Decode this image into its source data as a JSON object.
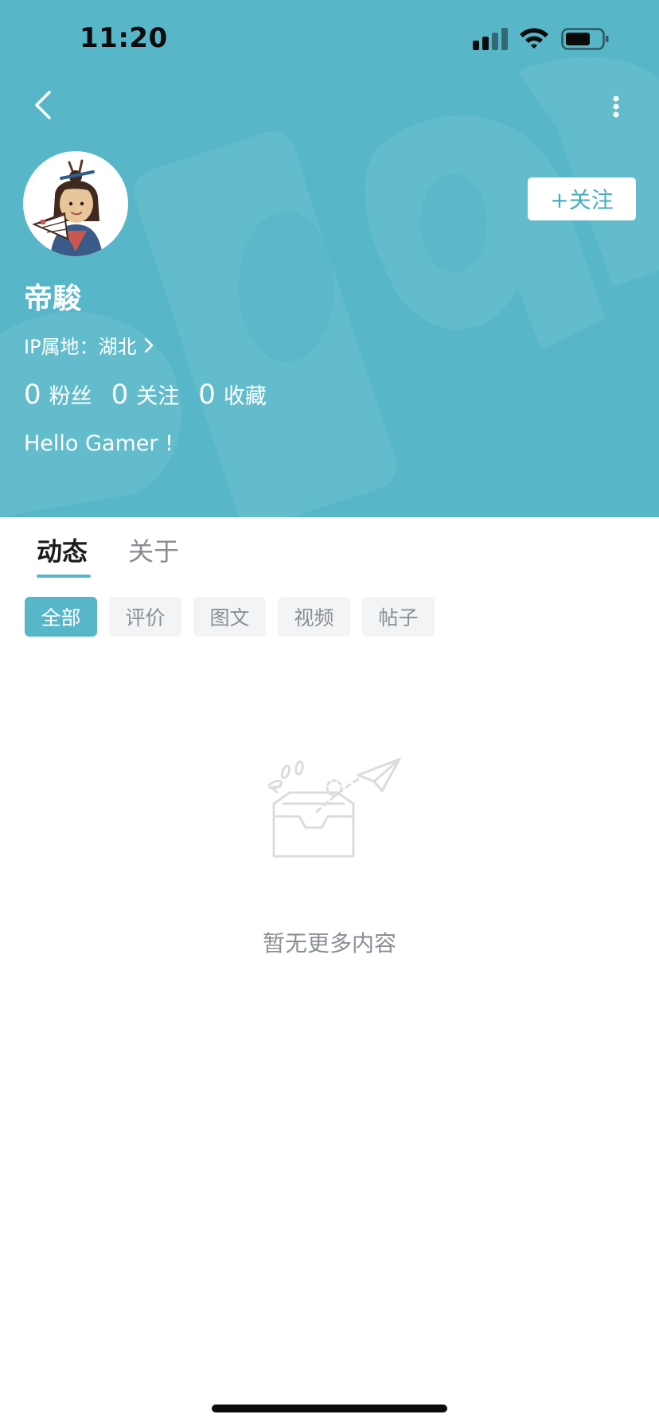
{
  "status_bar": {
    "time": "11:20"
  },
  "profile": {
    "follow_label": "+关注",
    "username": "帝駿",
    "ip_label": "IP属地：",
    "ip_value": "湖北",
    "stats": [
      {
        "value": "0",
        "label": "粉丝"
      },
      {
        "value": "0",
        "label": "关注"
      },
      {
        "value": "0",
        "label": "收藏"
      }
    ],
    "bio": "Hello Gamer !"
  },
  "tabs": [
    {
      "label": "动态",
      "active": true
    },
    {
      "label": "关于",
      "active": false
    }
  ],
  "filters": [
    {
      "label": "全部",
      "active": true
    },
    {
      "label": "评价",
      "active": false
    },
    {
      "label": "图文",
      "active": false
    },
    {
      "label": "视频",
      "active": false
    },
    {
      "label": "帖子",
      "active": false
    }
  ],
  "empty_state": {
    "message": "暂无更多内容"
  },
  "colors": {
    "accent": "#57b7c8",
    "header_bg": "#57b7c8",
    "chip_bg": "#f3f4f5",
    "muted_text": "#8a8f94"
  },
  "icons": {
    "back": "chevron-left-icon",
    "more": "more-vertical-icon",
    "empty": "empty-inbox-icon"
  }
}
